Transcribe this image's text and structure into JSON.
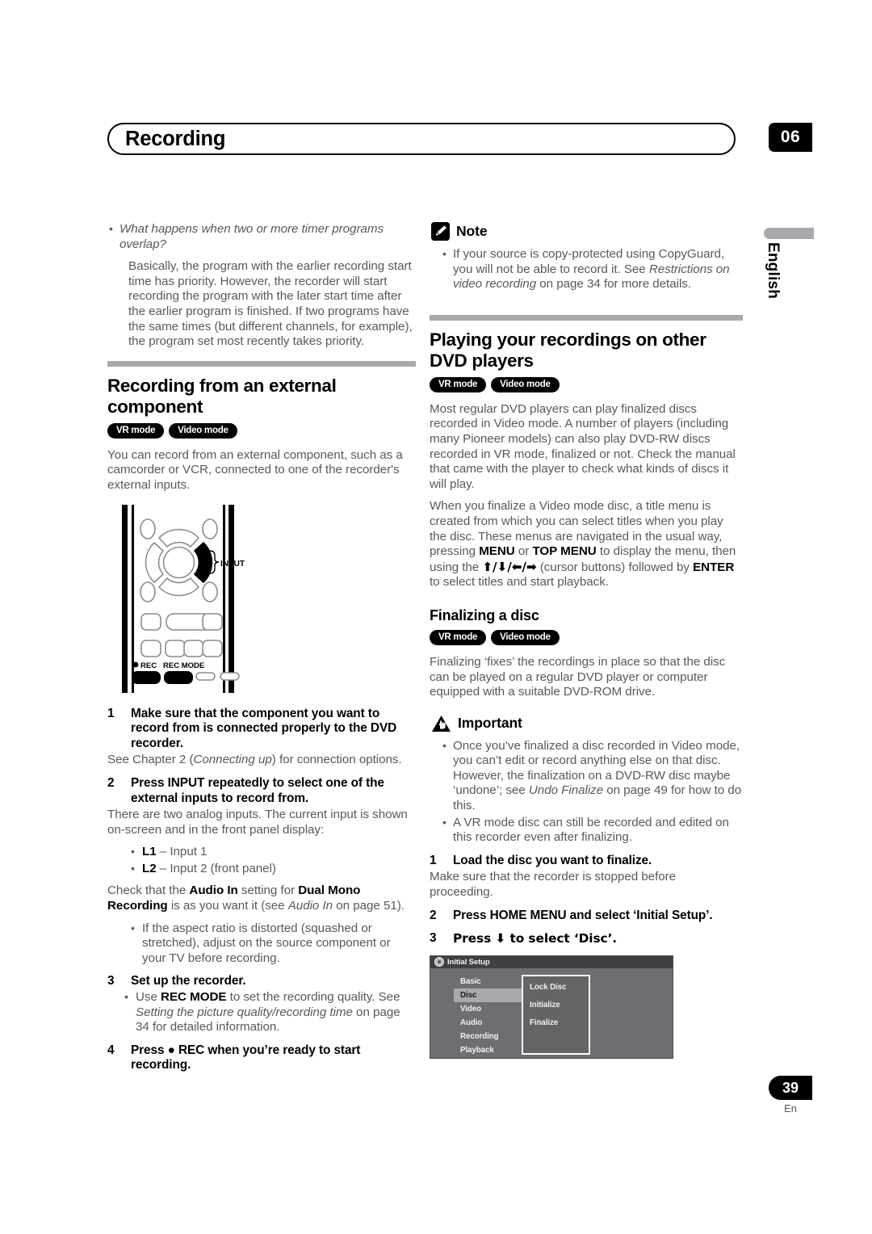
{
  "header": {
    "chapter_title": "Recording",
    "chapter_number": "06"
  },
  "side_tab": {
    "language": "English"
  },
  "footer": {
    "page_number": "39",
    "language_code": "En"
  },
  "left_column": {
    "overlap_question": "What happens when two or more timer programs overlap?",
    "overlap_answer": "Basically, the program with the earlier recording start time has priority. However, the recorder will start recording the program with the later start time after the earlier program is finished. If two programs have the same times (but different channels, for example), the program set most recently takes priority.",
    "section_title": "Recording from an external component",
    "badges": [
      "VR mode",
      "Video mode"
    ],
    "intro": "You can record from an external component, such as a camcorder or VCR, connected to one of the recorder's external inputs.",
    "remote": {
      "input_label": "INPUT",
      "rec_label": "REC",
      "rec_mode_label": "REC MODE"
    },
    "steps": [
      {
        "num": "1",
        "title": "Make sure that the component you want to record from is connected properly to the DVD recorder.",
        "body_pre": "See Chapter 2 (",
        "body_em": "Connecting up",
        "body_post": ") for connection options."
      },
      {
        "num": "2",
        "title": "Press INPUT repeatedly to select one of the external inputs to record from.",
        "body": "There are two analog inputs. The current input is shown on-screen and in the front panel display:"
      }
    ],
    "input_list": [
      {
        "bold": "L1",
        "rest": " – Input 1"
      },
      {
        "bold": "L2",
        "rest": " – Input 2 (front panel)"
      }
    ],
    "audio_in_note": {
      "pre": "Check that the ",
      "bold1": "Audio In",
      "mid1": " setting for ",
      "bold2": "Dual Mono Recording",
      "mid2": " is as you want it (see ",
      "em": "Audio In",
      "post": " on page 51)."
    },
    "aspect_bullet": "If the aspect ratio is distorted (squashed or stretched), adjust on the source component or your TV before recording.",
    "step3": {
      "num": "3",
      "title": "Set up the recorder.",
      "bullet": {
        "pre": "Use ",
        "bold": "REC MODE",
        "mid": " to set the recording quality. See ",
        "em": "Setting the picture quality/recording time",
        "post": " on page 34 for detailed information."
      }
    },
    "step4": {
      "num": "4",
      "title": "Press ● REC when you’re ready to start recording."
    }
  },
  "right_column": {
    "note": {
      "label": "Note",
      "bullet": {
        "pre": "If your source is copy-protected using CopyGuard, you will not be able to record it. See ",
        "em": "Restrictions on video recording",
        "post": " on page 34 for more details."
      }
    },
    "section_title": "Playing your recordings on other DVD players",
    "badges": [
      "VR mode",
      "Video mode"
    ],
    "para1": "Most regular DVD players can play finalized discs recorded in Video mode. A number of players (including many Pioneer models) can also play DVD-RW discs recorded in VR mode, finalized or not. Check the manual that came with the player to check what kinds of discs it will play.",
    "para2": {
      "pre": "When you finalize a Video mode disc, a title menu is created from which you can select titles when you play the disc. These menus are navigated in the usual way, pressing ",
      "bold1": "MENU",
      "mid1": " or ",
      "bold2": "TOP MENU",
      "mid2": " to display the menu, then using the ",
      "arrows": "⬆/⬇/⬅/➡",
      "mid3": " (cursor buttons) followed by ",
      "bold3": "ENTER",
      "post": " to select titles and start playback."
    },
    "sub_title": "Finalizing a disc",
    "sub_badges": [
      "VR mode",
      "Video mode"
    ],
    "para3": "Finalizing ‘fixes’ the recordings in place so that the disc can be played on a regular DVD player or computer equipped with a suitable DVD-ROM drive.",
    "important": {
      "label": "Important",
      "bullets": [
        {
          "pre": "Once you’ve finalized a disc recorded in Video mode, you can’t edit or record anything else on that disc. However, the finalization on a DVD-RW disc maybe ‘undone’; see ",
          "em": "Undo Finalize",
          "post": " on page 49 for how to do this."
        },
        {
          "pre": "A VR mode disc can still be recorded and edited on this recorder even after finalizing.",
          "em": "",
          "post": ""
        }
      ]
    },
    "steps": [
      {
        "num": "1",
        "title": "Load the disc you want to finalize.",
        "body": "Make sure that the recorder is stopped before proceeding."
      },
      {
        "num": "2",
        "title": "Press HOME MENU and select ‘Initial Setup’.",
        "body": ""
      },
      {
        "num": "3",
        "title": "Press ⬇ to select ‘Disc’.",
        "body": ""
      }
    ],
    "osd": {
      "title": "Initial Setup",
      "menu": [
        "Basic",
        "Disc",
        "Video",
        "Audio",
        "Recording",
        "Playback"
      ],
      "selected_menu": "Disc",
      "submenu": [
        "Lock Disc",
        "Initialize",
        "Finalize"
      ]
    }
  }
}
